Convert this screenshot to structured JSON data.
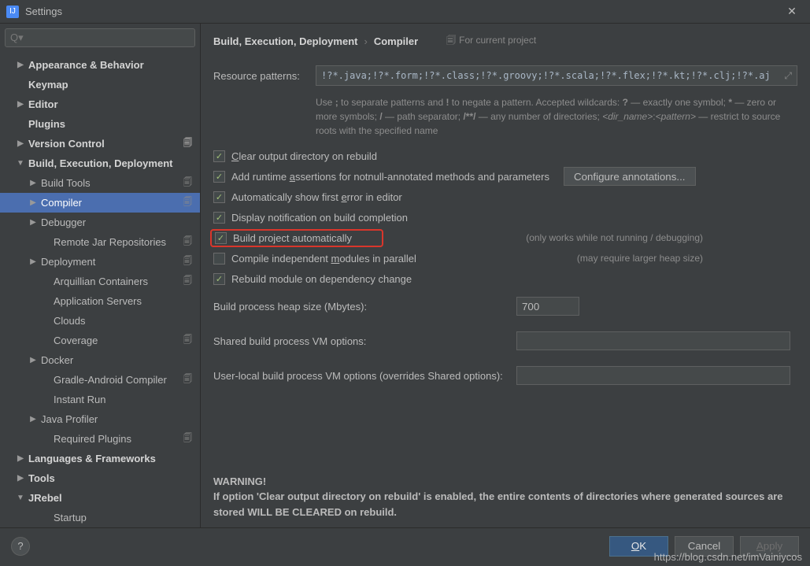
{
  "window": {
    "title": "Settings"
  },
  "search": {
    "placeholder": "Q▾"
  },
  "sidebar": {
    "items": [
      {
        "label": "Appearance & Behavior",
        "arrow": "▶",
        "level": "l1"
      },
      {
        "label": "Keymap",
        "level": "l1",
        "noarrow": true
      },
      {
        "label": "Editor",
        "arrow": "▶",
        "level": "l1"
      },
      {
        "label": "Plugins",
        "level": "l1",
        "noarrow": true
      },
      {
        "label": "Version Control",
        "arrow": "▶",
        "level": "l1",
        "badge": true
      },
      {
        "label": "Build, Execution, Deployment",
        "arrow": "▼",
        "level": "l1"
      },
      {
        "label": "Build Tools",
        "arrow": "▶",
        "level": "l2",
        "badge": true
      },
      {
        "label": "Compiler",
        "arrow": "▶",
        "level": "l2",
        "selected": true,
        "badge": true
      },
      {
        "label": "Debugger",
        "arrow": "▶",
        "level": "l2"
      },
      {
        "label": "Remote Jar Repositories",
        "level": "l3",
        "noarrow": true,
        "badge": true
      },
      {
        "label": "Deployment",
        "arrow": "▶",
        "level": "l2",
        "badge": true
      },
      {
        "label": "Arquillian Containers",
        "level": "l3",
        "noarrow": true,
        "badge": true
      },
      {
        "label": "Application Servers",
        "level": "l3",
        "noarrow": true
      },
      {
        "label": "Clouds",
        "level": "l3",
        "noarrow": true
      },
      {
        "label": "Coverage",
        "level": "l3",
        "noarrow": true,
        "badge": true
      },
      {
        "label": "Docker",
        "arrow": "▶",
        "level": "l2"
      },
      {
        "label": "Gradle-Android Compiler",
        "level": "l3",
        "noarrow": true,
        "badge": true
      },
      {
        "label": "Instant Run",
        "level": "l3",
        "noarrow": true
      },
      {
        "label": "Java Profiler",
        "arrow": "▶",
        "level": "l2"
      },
      {
        "label": "Required Plugins",
        "level": "l3",
        "noarrow": true,
        "badge": true
      },
      {
        "label": "Languages & Frameworks",
        "arrow": "▶",
        "level": "l1"
      },
      {
        "label": "Tools",
        "arrow": "▶",
        "level": "l1"
      },
      {
        "label": "JRebel",
        "arrow": "▼",
        "level": "l1"
      },
      {
        "label": "Startup",
        "level": "l3",
        "noarrow": true
      }
    ]
  },
  "breadcrumb": {
    "main": "Build, Execution, Deployment",
    "sep": "›",
    "sub": "Compiler",
    "project_hint": "For current project"
  },
  "resource": {
    "label": "Resource patterns:",
    "value": "!?*.java;!?*.form;!?*.class;!?*.groovy;!?*.scala;!?*.flex;!?*.kt;!?*.clj;!?*.aj",
    "hint": "Use ; to separate patterns and ! to negate a pattern. Accepted wildcards: ? — exactly one symbol; * — zero or more symbols; / — path separator; /**/ — any number of directories; <dir_name>:<pattern> — restrict to source roots with the specified name"
  },
  "checks": {
    "clear": "Clear output directory on rebuild",
    "assertions": "Add runtime assertions for notnull-annotated methods and parameters",
    "auto_error": "Automatically show first error in editor",
    "notify": "Display notification on build completion",
    "auto_build": "Build project automatically",
    "auto_build_hint": "(only works while not running / debugging)",
    "parallel": "Compile independent modules in parallel",
    "parallel_hint": "(may require larger heap size)",
    "rebuild_dep": "Rebuild module on dependency change",
    "config_btn": "Configure annotations..."
  },
  "forms": {
    "heap_label": "Build process heap size (Mbytes):",
    "heap_value": "700",
    "shared_label": "Shared build process VM options:",
    "local_label": "User-local build process VM options (overrides Shared options):"
  },
  "warning": {
    "title": "WARNING!",
    "body": "If option 'Clear output directory on rebuild' is enabled, the entire contents of directories where generated sources are stored WILL BE CLEARED on rebuild."
  },
  "footer": {
    "ok": "OK",
    "cancel": "Cancel",
    "apply": "Apply",
    "help": "?"
  },
  "watermark": "https://blog.csdn.net/imVainiycos"
}
